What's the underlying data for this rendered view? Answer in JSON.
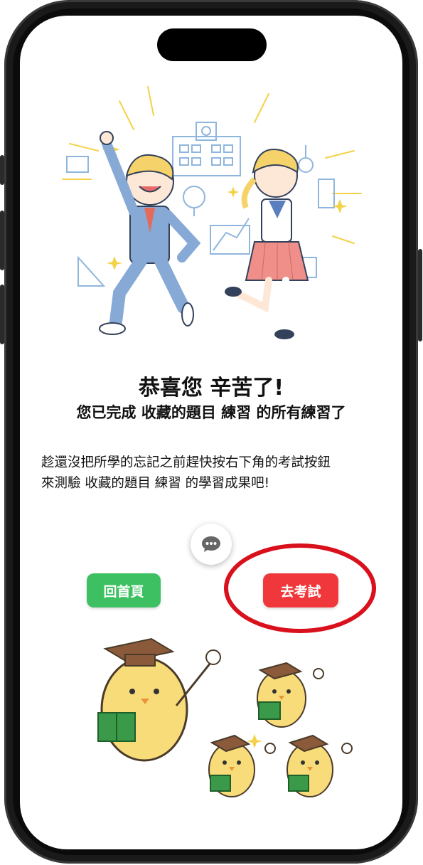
{
  "page": {
    "title_line": "恭喜您 辛苦了!",
    "subtitle_line": "您已完成 收藏的題目 練習 的所有練習了",
    "body_line1": "趁還沒把所學的忘記之前趕快按右下角的考試按鈕",
    "body_line2": "來測驗 收藏的題目 練習 的學習成果吧!"
  },
  "buttons": {
    "home_label": "回首頁",
    "exam_label": "去考試",
    "chat_icon": "chat-bubble-icon"
  },
  "colors": {
    "home_button": "#3cc061",
    "exam_button": "#f0383c",
    "highlight_circle": "#d9111c"
  }
}
